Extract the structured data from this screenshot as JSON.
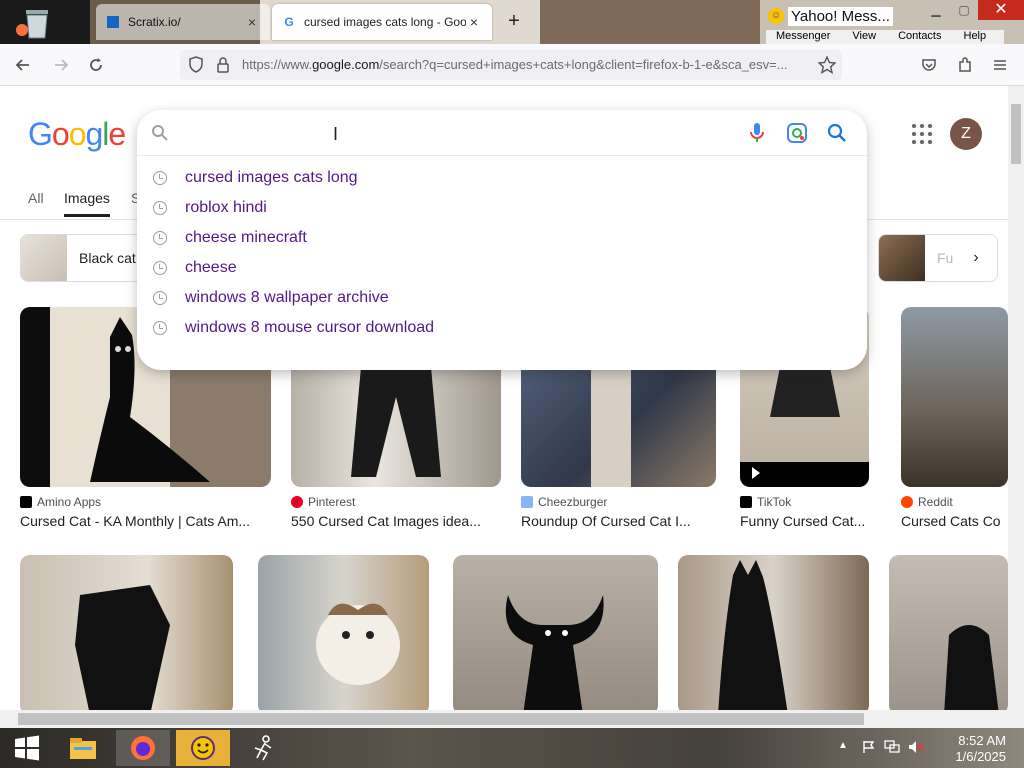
{
  "browser": {
    "tabs": [
      {
        "title": "Scratix.io/",
        "close": "×"
      },
      {
        "title": "cursed images cats long - Goog",
        "favicon": "G",
        "close": "×"
      }
    ],
    "new_tab": "+",
    "url_prefix": "https://www.",
    "url_domain": "google.com",
    "url_rest": "/search?q=cursed+images+cats+long&client=firefox-b-1-e&sca_esv=..."
  },
  "yahoo": {
    "title": "Yahoo! Mess...",
    "menu": [
      "Messenger",
      "View",
      "Contacts",
      "Help"
    ]
  },
  "google": {
    "logo": [
      "G",
      "o",
      "o",
      "g",
      "l",
      "e"
    ],
    "avatar_letter": "Z",
    "search_value": "",
    "suggestions": [
      "cursed images cats long",
      "roblox hindi",
      "cheese minecraft",
      "cheese",
      "windows 8 wallpaper archive",
      "windows 8 mouse cursor download"
    ],
    "tabs": [
      "All",
      "Images",
      "S"
    ],
    "chips": [
      {
        "label": "Black cat"
      },
      {
        "label": "Fu"
      }
    ],
    "row1": [
      {
        "source": "Amino Apps",
        "caption": "Cursed Cat - KA Monthly | Cats Am...",
        "src_color": "#000000"
      },
      {
        "source": "Pinterest",
        "caption": "550 Cursed Cat Images idea...",
        "src_color": "#e60023"
      },
      {
        "source": "Cheezburger",
        "caption": "Roundup Of Cursed Cat I...",
        "src_color": "#8ab4f8"
      },
      {
        "source": "TikTok",
        "caption": "Funny Cursed Cat...",
        "src_color": "#000000"
      },
      {
        "source": "Reddit",
        "caption": "Cursed Cats Co",
        "src_color": "#ff4500"
      }
    ]
  },
  "taskbar": {
    "time": "8:52 AM",
    "date": "1/6/2025"
  },
  "colors": {
    "accent": "#1a73e8",
    "visited_link": "#52188c"
  }
}
